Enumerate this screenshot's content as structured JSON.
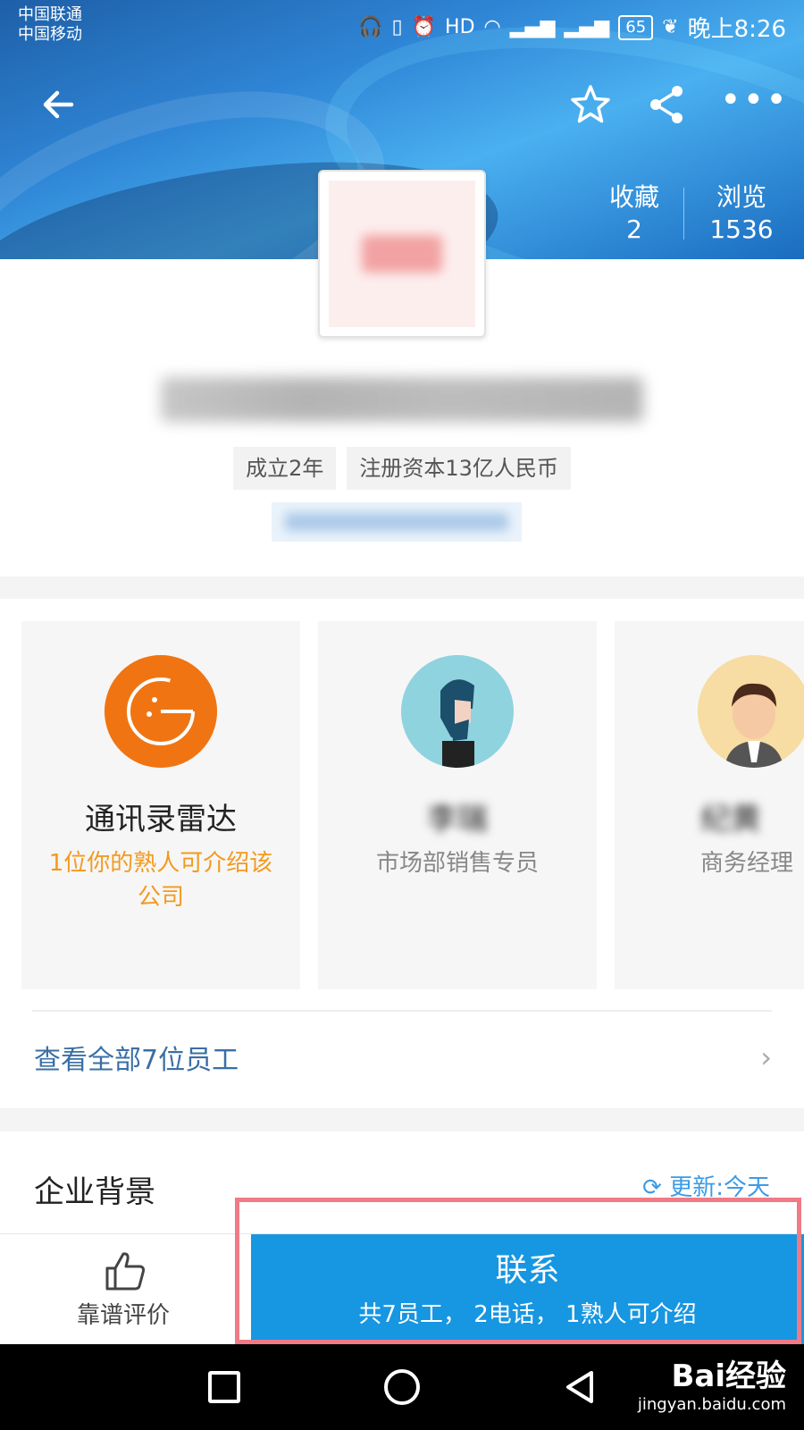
{
  "status_bar": {
    "carrier_1": "中国联通",
    "carrier_2": "中国移动",
    "battery": "65",
    "time": "晚上8:26"
  },
  "header": {
    "stats": {
      "favorites_label": "收藏",
      "favorites_value": "2",
      "views_label": "浏览",
      "views_value": "1536"
    }
  },
  "company": {
    "tags": [
      "成立2年",
      "注册资本13亿人民币"
    ]
  },
  "people": {
    "cards": [
      {
        "title": "通讯录雷达",
        "subtitle": "1位你的熟人可介绍该公司"
      },
      {
        "title": "李瑞",
        "subtitle": "市场部销售专员"
      },
      {
        "title": "纪黄",
        "subtitle": "商务经理"
      }
    ],
    "view_all": "查看全部7位员工"
  },
  "background": {
    "title": "企业背景",
    "update": "更新:今天"
  },
  "action_bar": {
    "rate_label": "靠谱评价",
    "contact_title": "联系",
    "contact_subtitle": "共7员工， 2电话， 1熟人可介绍"
  },
  "watermark": {
    "main": "Bai经验",
    "sub": "jingyan.baidu.com"
  },
  "colors": {
    "accent": "#1796e1",
    "orange": "#f29a1e",
    "link": "#3a6fa6",
    "highlight": "#f07a86"
  }
}
